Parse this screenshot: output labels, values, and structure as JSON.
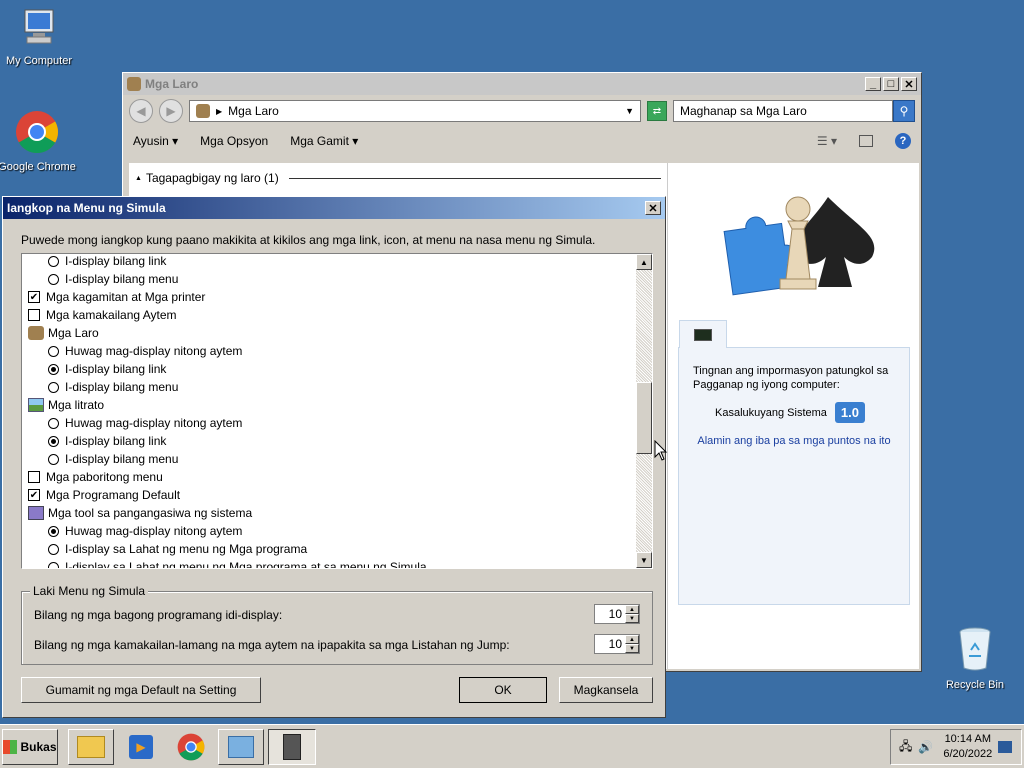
{
  "desktop": {
    "icons": [
      {
        "label": "My Computer",
        "icon": "computer-icon"
      },
      {
        "label": "Google Chrome",
        "icon": "chrome-icon"
      },
      {
        "label": "Recycle Bin",
        "icon": "recycle-bin-icon"
      }
    ]
  },
  "explorer": {
    "title": "Mga Laro",
    "address": "Mga Laro",
    "search_placeholder": "Maghanap sa Mga Laro",
    "commands": [
      "Ayusin",
      "Mga Opsyon",
      "Mga Gamit"
    ],
    "group_header": "Tagapagbigay ng laro (1)",
    "perf": {
      "tab_icon": "performance-icon",
      "text": "Tingnan ang impormasyon patungkol sa Pagganap ng iyong computer:",
      "label": "Kasalukuyang Sistema",
      "score": "1.0",
      "link": "Alamin ang iba pa sa mga puntos na ito"
    }
  },
  "dialog": {
    "title": "Iangkop na Menu ng Simula",
    "description": "Puwede mong iangkop kung paano makikita at kikilos ang mga link, icon, at menu na nasa menu ng Simula.",
    "items": [
      {
        "type": "radio",
        "indent": true,
        "checked": false,
        "label": "I-display bilang link"
      },
      {
        "type": "radio",
        "indent": true,
        "checked": false,
        "label": "I-display bilang menu"
      },
      {
        "type": "check",
        "checked": true,
        "label": "Mga kagamitan at Mga printer"
      },
      {
        "type": "check",
        "checked": false,
        "label": "Mga kamakailang Aytem"
      },
      {
        "type": "header",
        "icon": "games-icon",
        "label": "Mga Laro"
      },
      {
        "type": "radio",
        "indent": true,
        "checked": false,
        "label": "Huwag mag-display nitong aytem"
      },
      {
        "type": "radio",
        "indent": true,
        "checked": true,
        "label": "I-display bilang link"
      },
      {
        "type": "radio",
        "indent": true,
        "checked": false,
        "label": "I-display bilang menu"
      },
      {
        "type": "header",
        "icon": "pictures-icon",
        "label": "Mga litrato"
      },
      {
        "type": "radio",
        "indent": true,
        "checked": false,
        "label": "Huwag mag-display nitong aytem"
      },
      {
        "type": "radio",
        "indent": true,
        "checked": true,
        "label": "I-display bilang link"
      },
      {
        "type": "radio",
        "indent": true,
        "checked": false,
        "label": "I-display bilang menu"
      },
      {
        "type": "check",
        "checked": false,
        "label": "Mga paboritong menu"
      },
      {
        "type": "check",
        "checked": true,
        "label": "Mga Programang Default"
      },
      {
        "type": "header",
        "icon": "admin-tools-icon",
        "label": "Mga tool sa pangangasiwa ng sistema"
      },
      {
        "type": "radio",
        "indent": true,
        "checked": true,
        "label": "Huwag mag-display nitong aytem"
      },
      {
        "type": "radio",
        "indent": true,
        "checked": false,
        "label": "I-display sa Lahat ng  menu ng Mga programa"
      },
      {
        "type": "radio",
        "indent": true,
        "checked": false,
        "label": "I-display sa Lahat ng  menu ng Mga programa at sa menu ng Simula"
      }
    ],
    "size_group": {
      "title": "Laki Menu ng Simula",
      "recent_programs_label": "Bilang ng mga bagong programang idi-display:",
      "recent_programs_value": "10",
      "jump_list_label": "Bilang ng mga kamakailan-lamang na mga aytem na ipapakita sa mga Listahan ng Jump:",
      "jump_list_value": "10"
    },
    "buttons": {
      "defaults": "Gumamit ng mga Default na Setting",
      "ok": "OK",
      "cancel": "Magkansela"
    }
  },
  "taskbar": {
    "start_label": "Bukas",
    "time": "10:14 AM",
    "date": "6/20/2022"
  }
}
